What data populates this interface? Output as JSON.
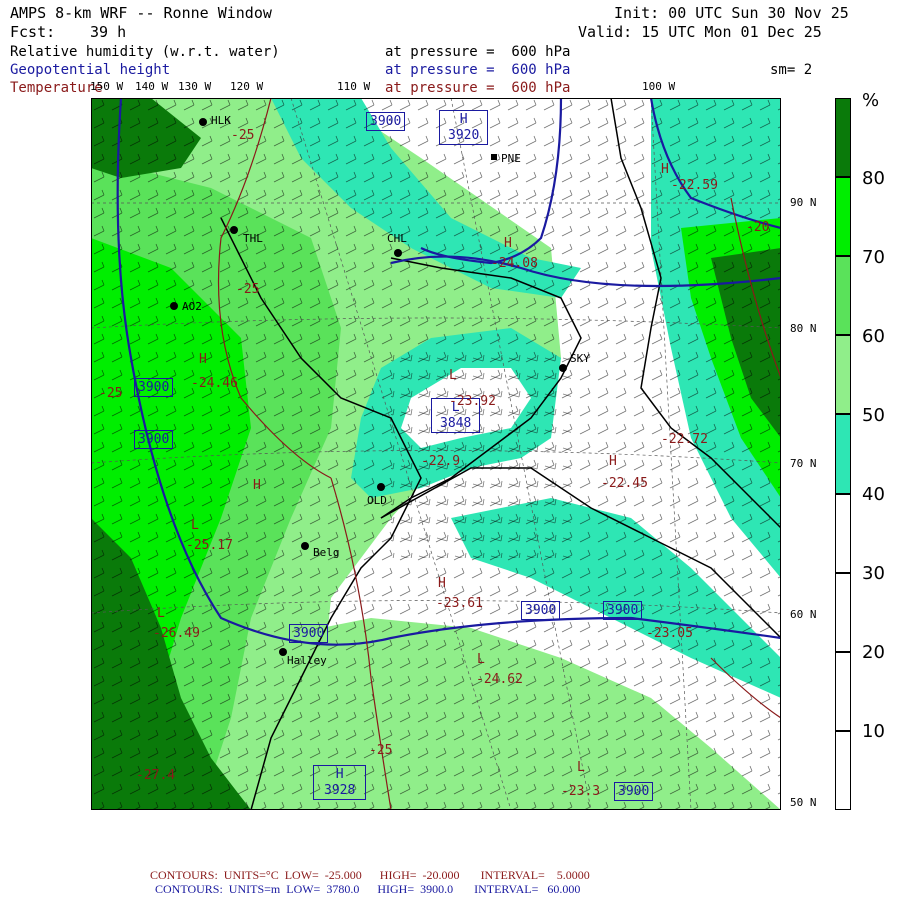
{
  "header": {
    "title": "AMPS 8-km WRF -- Ronne Window",
    "fcst_label": "Fcst:",
    "fcst_value": "39 h",
    "init": "Init: 00 UTC Sun 30 Nov 25",
    "valid": "Valid: 15 UTC Mon 01 Dec 25",
    "sm": "sm= 2",
    "fields": [
      {
        "name": "Relative humidity (w.r.t. water)",
        "level": "at pressure =  600 hPa",
        "color": "#000000"
      },
      {
        "name": "Geopotential height",
        "level": "at pressure =  600 hPa",
        "color": "#1a1aa0"
      },
      {
        "name": "Temperature",
        "level": "at pressure =  600 hPa",
        "color": "#8a1a1a"
      }
    ]
  },
  "longitudes": [
    "150 W",
    "140 W",
    "130 W",
    "120 W",
    "110 W",
    "100 W"
  ],
  "latitudes": [
    "90 N",
    "80 N",
    "70 N",
    "60 N",
    "50 N"
  ],
  "stations": [
    {
      "name": "HLK"
    },
    {
      "name": "THL"
    },
    {
      "name": "AO2"
    },
    {
      "name": "PNE"
    },
    {
      "name": "CHL"
    },
    {
      "name": "SKY"
    },
    {
      "name": "OLD"
    },
    {
      "name": "Belg"
    },
    {
      "name": "Halley"
    }
  ],
  "height_boxes": [
    "3900",
    "3920",
    "3900",
    "3900",
    "3848",
    "3900",
    "3900",
    "3900",
    "3928",
    "3900"
  ],
  "temperature_labels": [
    "-25",
    "-25",
    "-24.46",
    "-25",
    "-22.59",
    "-20",
    "-24.08",
    "-23.92",
    "-22.9",
    "-22.72",
    "-22.45",
    "-25.17",
    "-23.61",
    "-23.05",
    "-26.49",
    "-24.62",
    "-25",
    "-23.3",
    "-27.4"
  ],
  "hl_markers": [
    "H",
    "H",
    "H",
    "L",
    "H",
    "L",
    "H",
    "L",
    "H",
    "L",
    "L",
    "H",
    "L",
    "H"
  ],
  "colorbar": {
    "unit": "%",
    "ticks": [
      "80",
      "70",
      "60",
      "50",
      "40",
      "30",
      "20",
      "10"
    ],
    "colors": [
      "#ffffff",
      "#ffffff",
      "#ffffff",
      "#2ee6b4",
      "#90ee8a",
      "#5ae25a",
      "#00ee00",
      "#0a7a0a"
    ]
  },
  "footer": [
    {
      "label": "CONTOURS:",
      "units": "UNITS=°C",
      "low": "LOW=  -25.000",
      "high": "HIGH=  -20.000",
      "interval": "INTERVAL=    5.0000",
      "color": "#8a1a1a"
    },
    {
      "label": "CONTOURS:",
      "units": "UNITS=m",
      "low": "LOW=  3780.0",
      "high": "HIGH=  3900.0",
      "interval": "INTERVAL=   60.000",
      "color": "#1a1aa0"
    }
  ]
}
